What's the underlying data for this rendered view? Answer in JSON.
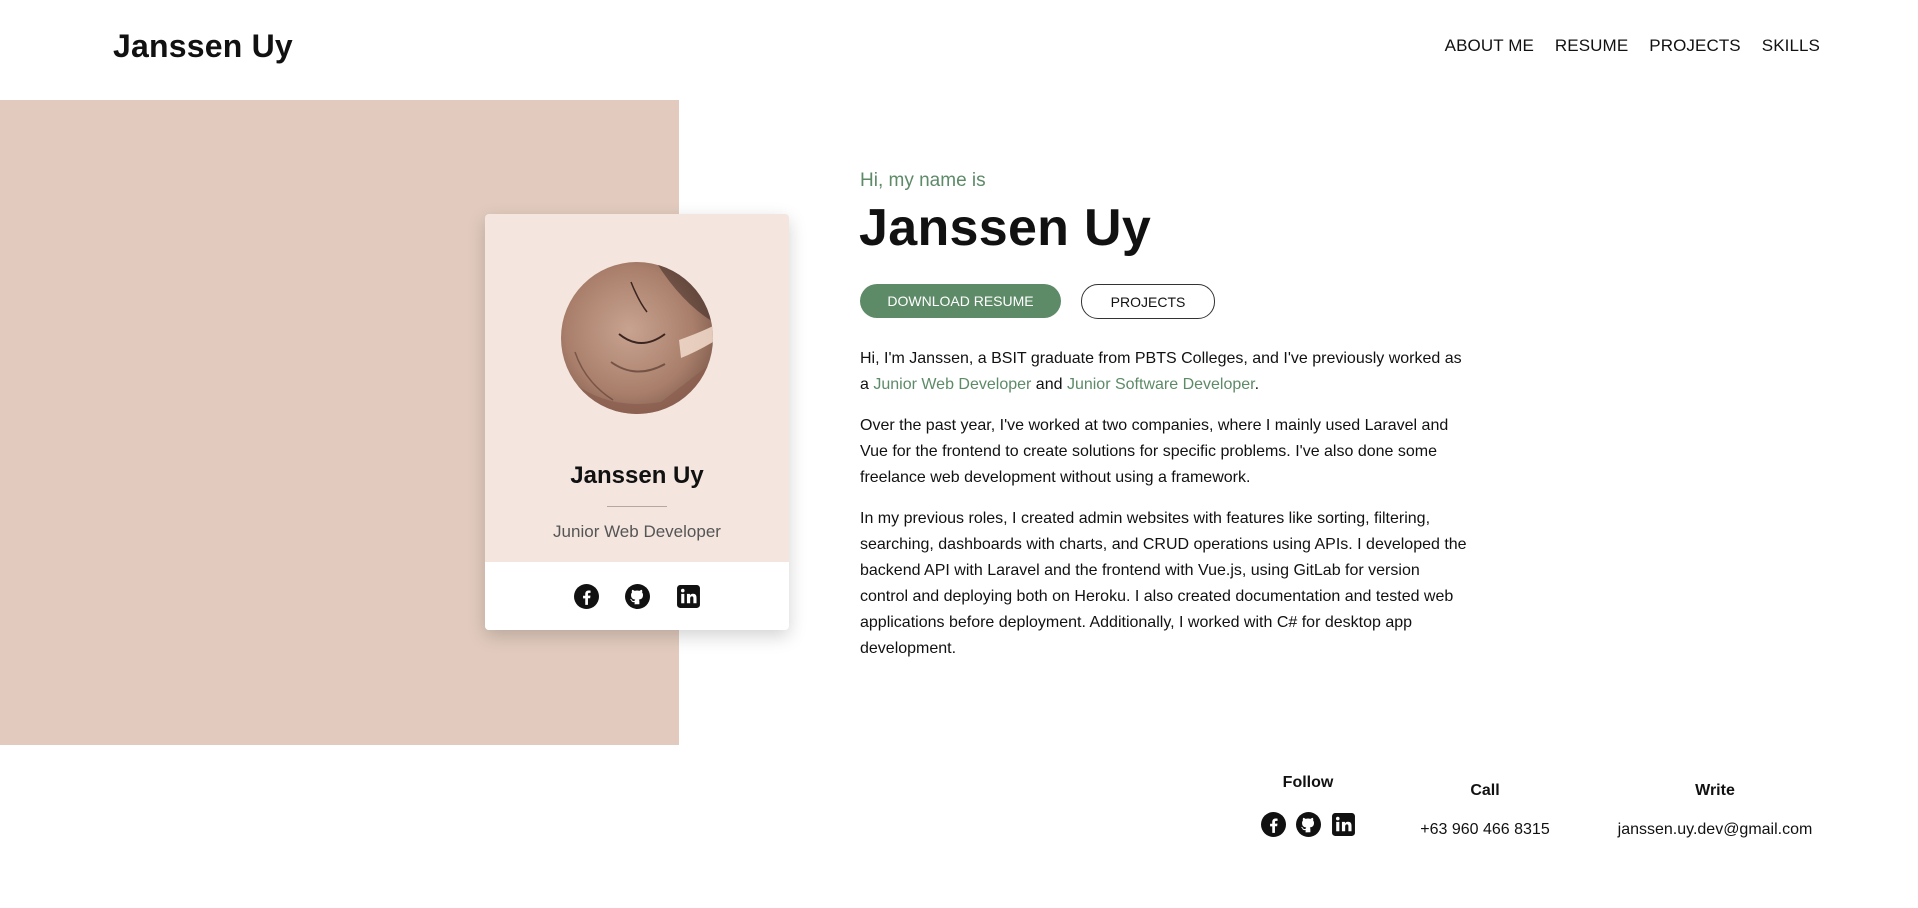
{
  "header": {
    "brand": "Janssen Uy",
    "nav": [
      "ABOUT ME",
      "RESUME",
      "PROJECTS",
      "SKILLS"
    ]
  },
  "card": {
    "name": "Janssen Uy",
    "role": "Junior Web Developer",
    "social_icons": [
      "facebook-icon",
      "github-icon",
      "linkedin-icon"
    ]
  },
  "intro": {
    "greeting": "Hi, my name is",
    "name": "Janssen Uy",
    "primary_button": "DOWNLOAD RESUME",
    "secondary_button": "PROJECTS"
  },
  "bio": {
    "p1_pre": "Hi, I'm Janssen, a BSIT graduate from PBTS Colleges, and I've previously worked as a ",
    "p1_role1": "Junior Web Developer",
    "p1_mid": " and ",
    "p1_role2": "Junior Software Developer",
    "p1_post": ".",
    "p2": "Over the past year, I've worked at two companies, where I mainly used Laravel and Vue for the frontend to create solutions for specific problems. I've also done some freelance web development without using a framework.",
    "p3": "In my previous roles, I created admin websites with features like sorting, filtering, searching, dashboards with charts, and CRUD operations using APIs. I developed the backend API with Laravel and the frontend with Vue.js, using GitLab for version control and deploying both on Heroku. I also created documentation and tested web applications before deployment. Additionally, I worked with C# for desktop app development."
  },
  "contact": {
    "follow_title": "Follow",
    "call_title": "Call",
    "call_value": "+63 960 466 8315",
    "write_title": "Write",
    "write_value": "janssen.uy.dev@gmail.com"
  },
  "colors": {
    "accent": "#5d8a67",
    "panel": "#e2cbbe",
    "card": "#f4e6df"
  }
}
